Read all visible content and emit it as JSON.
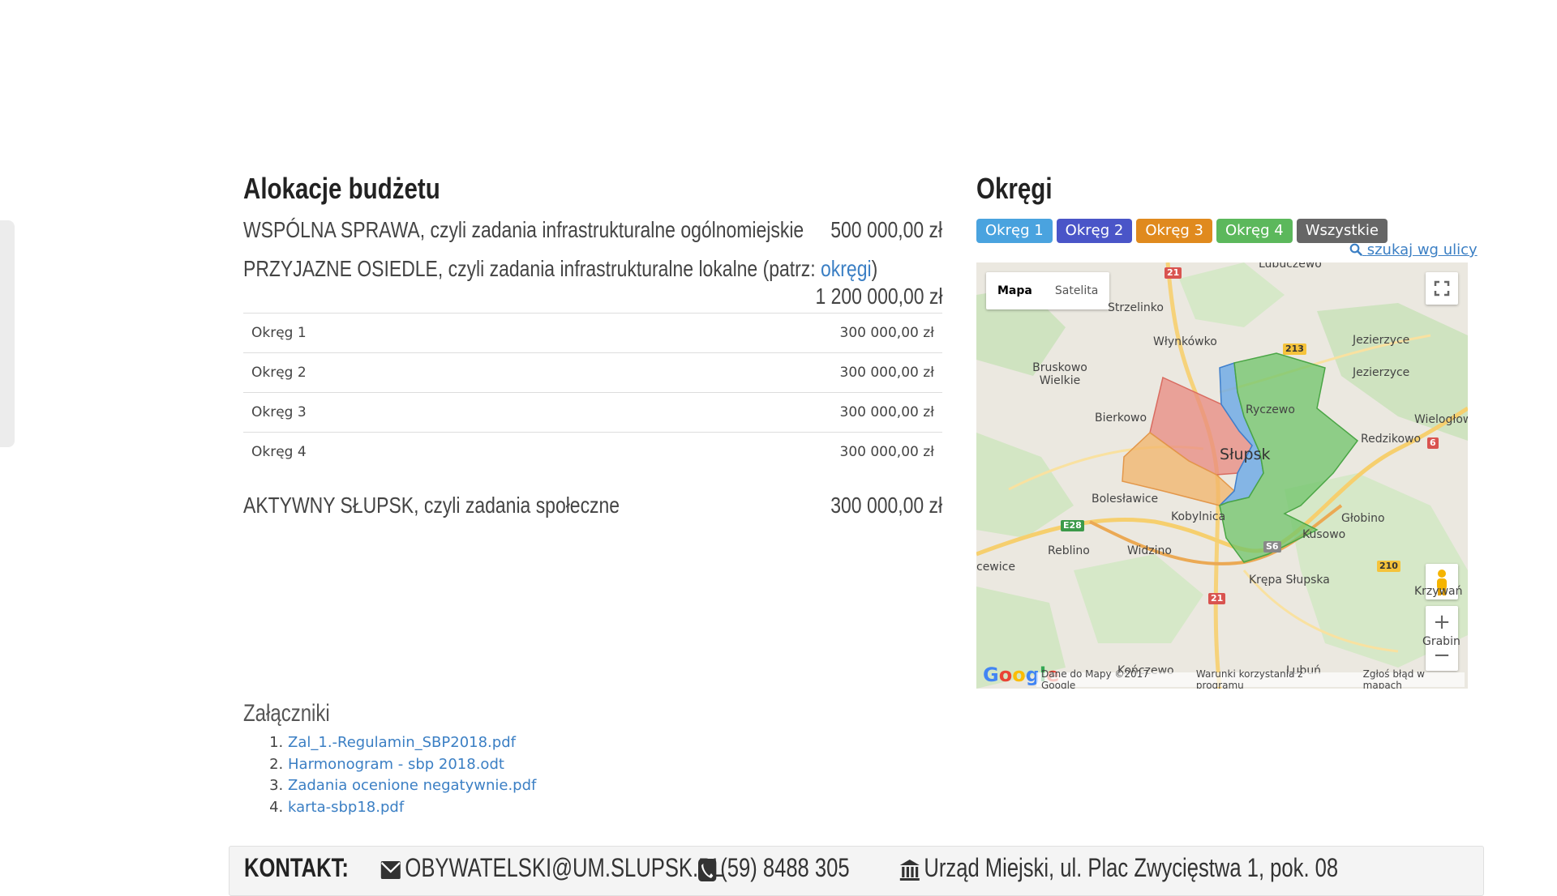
{
  "budget": {
    "heading": "Alokacje budżetu",
    "rows": [
      {
        "label": "WSPÓLNA SPRAWA, czyli zadania infrastrukturalne ogólnomiejskie",
        "amount": "500 000,00 zł"
      },
      {
        "label": "PRZYJAZNE OSIEDLE, czyli zadania infrastrukturalne lokalne (patrz: ",
        "link": "okręgi",
        "label_end": ")",
        "amount": "1 200 000,00 zł"
      },
      {
        "label": "AKTYWNY SŁUPSK, czyli zadania społeczne",
        "amount": "300 000,00 zł"
      }
    ],
    "districts": [
      {
        "name": "Okręg 1",
        "amount": "300 000,00 zł"
      },
      {
        "name": "Okręg 2",
        "amount": "300 000,00 zł"
      },
      {
        "name": "Okręg 3",
        "amount": "300 000,00 zł"
      },
      {
        "name": "Okręg 4",
        "amount": "300 000,00 zł"
      }
    ]
  },
  "districts_panel": {
    "heading": "Okręgi",
    "filters": [
      {
        "label": "Okręg 1",
        "color": "#4aa3df"
      },
      {
        "label": "Okręg 2",
        "color": "#4a55c8"
      },
      {
        "label": "Okręg 3",
        "color": "#e08a1e"
      },
      {
        "label": "Okręg 4",
        "color": "#5cb85c"
      },
      {
        "label": "Wszystkie",
        "color": "#666666"
      }
    ],
    "search_link": "szukaj wg ulicy"
  },
  "map": {
    "type_map": "Mapa",
    "type_satellite": "Satelita",
    "city": "Słupsk",
    "labels": [
      "Lubuczewo",
      "Strzelinko",
      "Włynkówko",
      "Jezierzyce",
      "Jezierzyce",
      "Bruskowo Wielkie",
      "Ryczewo",
      "Bierkowo",
      "Wielogłow",
      "Redzikowo",
      "Bolesławice",
      "Kobylnica",
      "Głobino",
      "Reblino",
      "Widzino",
      "Kusowo",
      "cewice",
      "Krępa Słupska",
      "Krzywań",
      "Grabin",
      "Kończewo",
      "Lubuń"
    ],
    "road_numbers": [
      "21",
      "213",
      "6",
      "E28",
      "S6",
      "210",
      "21"
    ],
    "footer": [
      "Dane do Mapy ©2017 Google",
      "Warunki korzystania z programu",
      "Zgłoś błąd w mapach"
    ],
    "google": "Google"
  },
  "attachments": {
    "heading": "Załączniki",
    "files": [
      "Zal_1.-Regulamin_SBP2018.pdf",
      "Harmonogram - sbp 2018.odt",
      "Zadania ocenione negatywnie.pdf",
      "karta-sbp18.pdf"
    ]
  },
  "contact": {
    "title": "KONTAKT:",
    "email": "OBYWATELSKI@UM.SLUPSK.PL",
    "phone": "(59) 8488 305",
    "address": "Urząd Miejski, ul. Plac Zwycięstwa 1, pok. 08"
  }
}
